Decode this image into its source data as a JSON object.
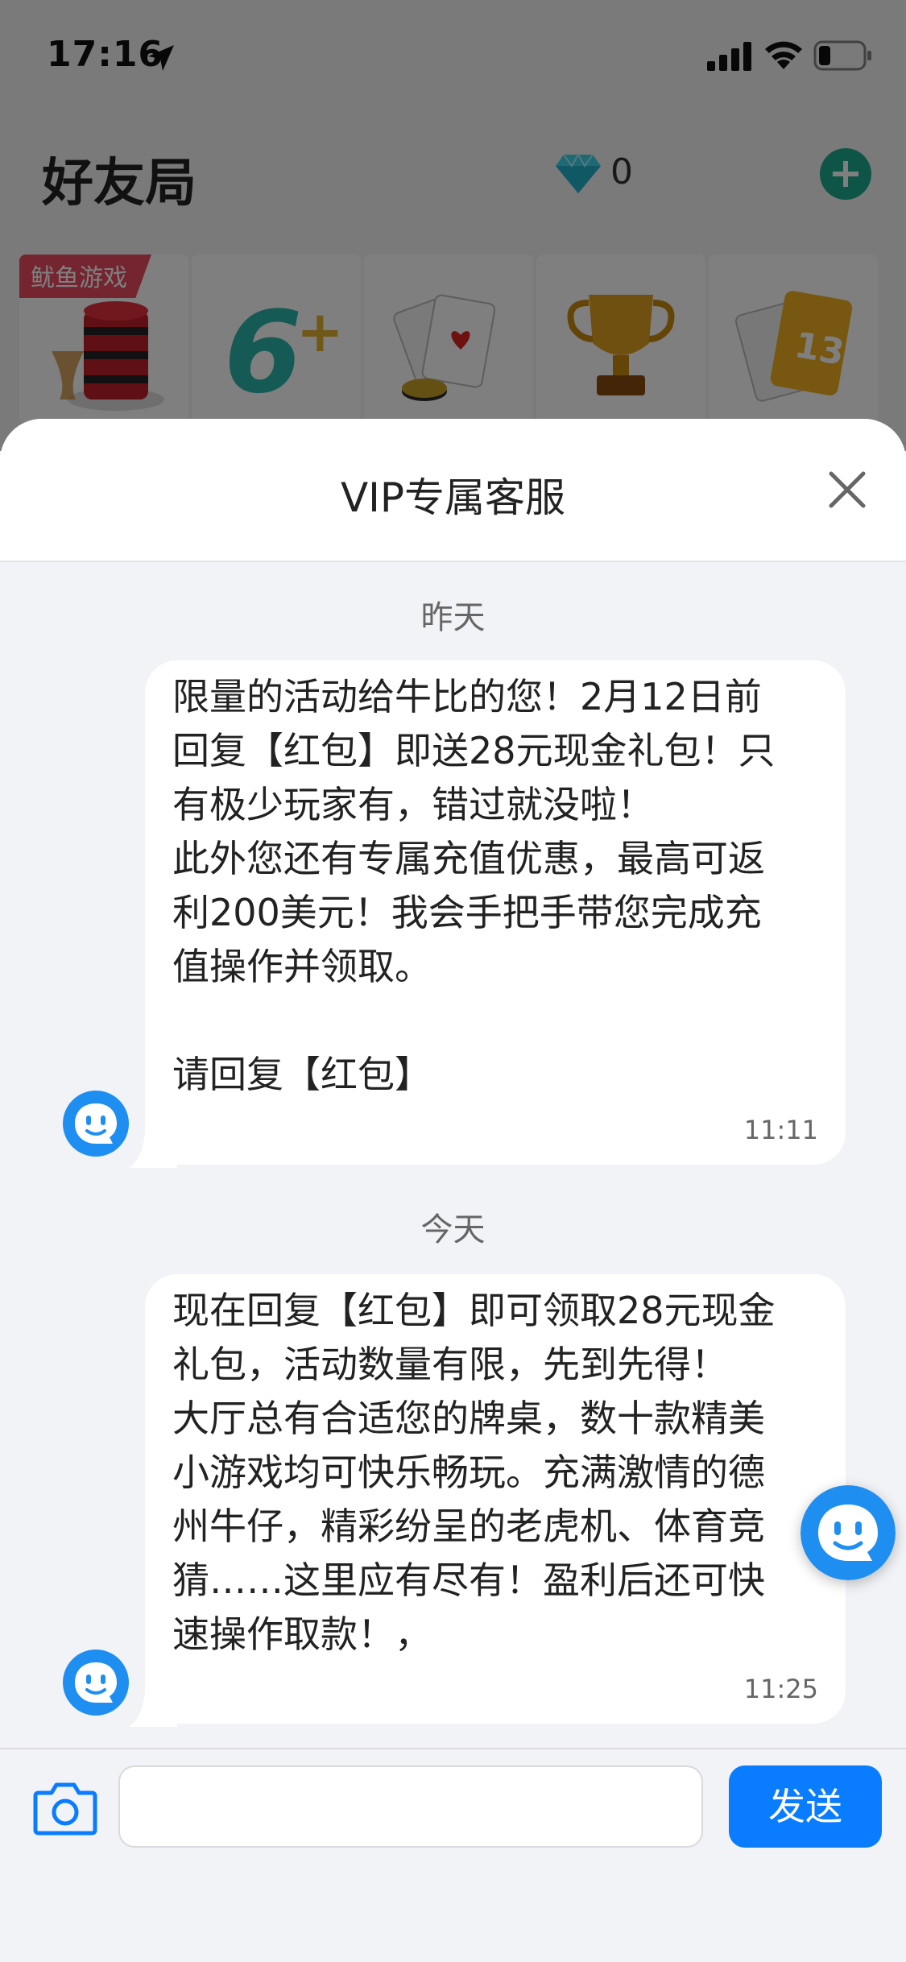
{
  "status_bar": {
    "time": "17:16"
  },
  "background_app": {
    "title": "好友局",
    "gem_count": "0",
    "games": [
      {
        "badge": "鱿鱼游戏",
        "icon": "poker-chips-icon"
      },
      {
        "badge": "",
        "icon": "six-plus-icon"
      },
      {
        "badge": "",
        "icon": "playing-cards-icon"
      },
      {
        "badge": "",
        "icon": "trophy-icon"
      },
      {
        "badge": "",
        "icon": "thirteen-cards-icon"
      }
    ]
  },
  "chat": {
    "title": "VIP专属客服",
    "messages": [
      {
        "date": "昨天",
        "text": "限量的活动给牛比的您！2月12日前\n回复【红包】即送28元现金礼包！只\n有极少玩家有，错过就没啦！\n此外您还有专属充值优惠，最高可返\n利200美元！我会手把手带您完成充\n值操作并领取。\n\n请回复【红包】",
        "time": "11:11"
      },
      {
        "date": "今天",
        "text": "现在回复【红包】即可领取28元现金\n礼包，活动数量有限，先到先得！\n大厅总有合适您的牌桌，数十款精美\n小游戏均可快乐畅玩。充满激情的德\n州牛仔，精彩纷呈的老虎机、体育竞\n猜……这里应有尽有！盈利后还可快\n速操作取款！，",
        "time": "11:25"
      }
    ],
    "input_value": "",
    "send_label": "发送"
  },
  "colors": {
    "accent": "#0a7cff",
    "avatar_blue": "#1f8ef1",
    "plus_green": "#1eaa8e",
    "badge_red": "#e84a5f"
  }
}
